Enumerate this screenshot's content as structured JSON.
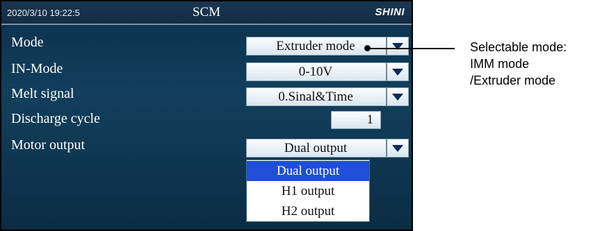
{
  "header": {
    "datetime": "2020/3/10 19:22:5",
    "title": "SCM",
    "brand": "SHINI"
  },
  "settings": [
    {
      "label": "Mode",
      "value": "Extruder mode"
    },
    {
      "label": "IN-Mode",
      "value": "0-10V"
    },
    {
      "label": "Melt signal",
      "value": "0.Sinal&Time"
    },
    {
      "label": "Discharge cycle",
      "value": "1"
    },
    {
      "label": "Motor output",
      "value": "Dual output"
    }
  ],
  "motor_output_options": [
    {
      "label": "Dual output",
      "selected": true
    },
    {
      "label": "H1 output",
      "selected": false
    },
    {
      "label": "H2 output",
      "selected": false
    }
  ],
  "annotation": {
    "line1": "Selectable mode:",
    "line2": "IMM mode",
    "line3": "/Extruder mode"
  },
  "colors": {
    "screen_bg": "#123f5c",
    "selected_option_bg": "#1e4fd6",
    "combo_arrow": "#0c2a5e"
  },
  "icons": [
    "dropdown-arrow-icon"
  ]
}
